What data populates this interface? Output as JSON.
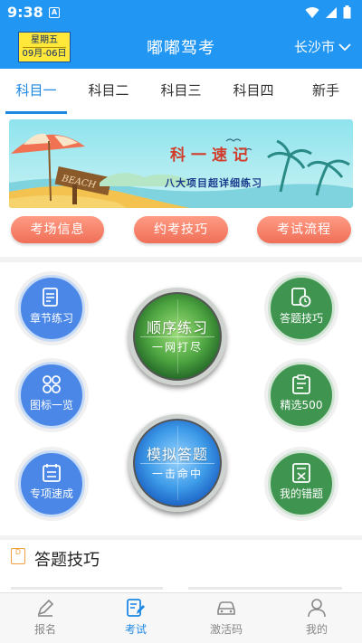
{
  "status_bar": {
    "time": "9:38",
    "notification_letter": "A"
  },
  "app_bar": {
    "date_badge": {
      "weekday": "星期五",
      "date": "09月-06日"
    },
    "title": "嘟嘟驾考",
    "city": "长沙市"
  },
  "tabs": [
    {
      "label": "科目一",
      "active": true
    },
    {
      "label": "科目二",
      "active": false
    },
    {
      "label": "科目三",
      "active": false
    },
    {
      "label": "科目四",
      "active": false
    },
    {
      "label": "新手",
      "active": false
    }
  ],
  "banner": {
    "title": "科一速记",
    "subtitle": "八大项目超详细练习",
    "sign_text": "BEACH"
  },
  "quick_links": [
    "考场信息",
    "约考技巧",
    "考试流程"
  ],
  "features": {
    "chapter_practice": "章节练习",
    "icon_overview": "图标一览",
    "topic_drill": "专项速成",
    "answer_tips": "答题技巧",
    "selected_500": "精选500",
    "my_mistakes": "我的错题"
  },
  "big_buttons": {
    "sequential": {
      "title": "顺序练习",
      "sub": "一网打尽"
    },
    "mock_exam": {
      "title": "模拟答题",
      "sub": "一击命中"
    }
  },
  "tips_section": {
    "icon_letter": "D",
    "title": "答题技巧"
  },
  "bottom_nav": [
    {
      "label": "报名",
      "active": false
    },
    {
      "label": "考试",
      "active": true
    },
    {
      "label": "激活码",
      "active": false
    },
    {
      "label": "我的",
      "active": false
    }
  ],
  "colors": {
    "primary": "#2196f3",
    "accent_tab": "#1e88e5",
    "pill": "#f47a62",
    "feature_blue": "#4a87e6",
    "feature_green": "#3f944f"
  }
}
